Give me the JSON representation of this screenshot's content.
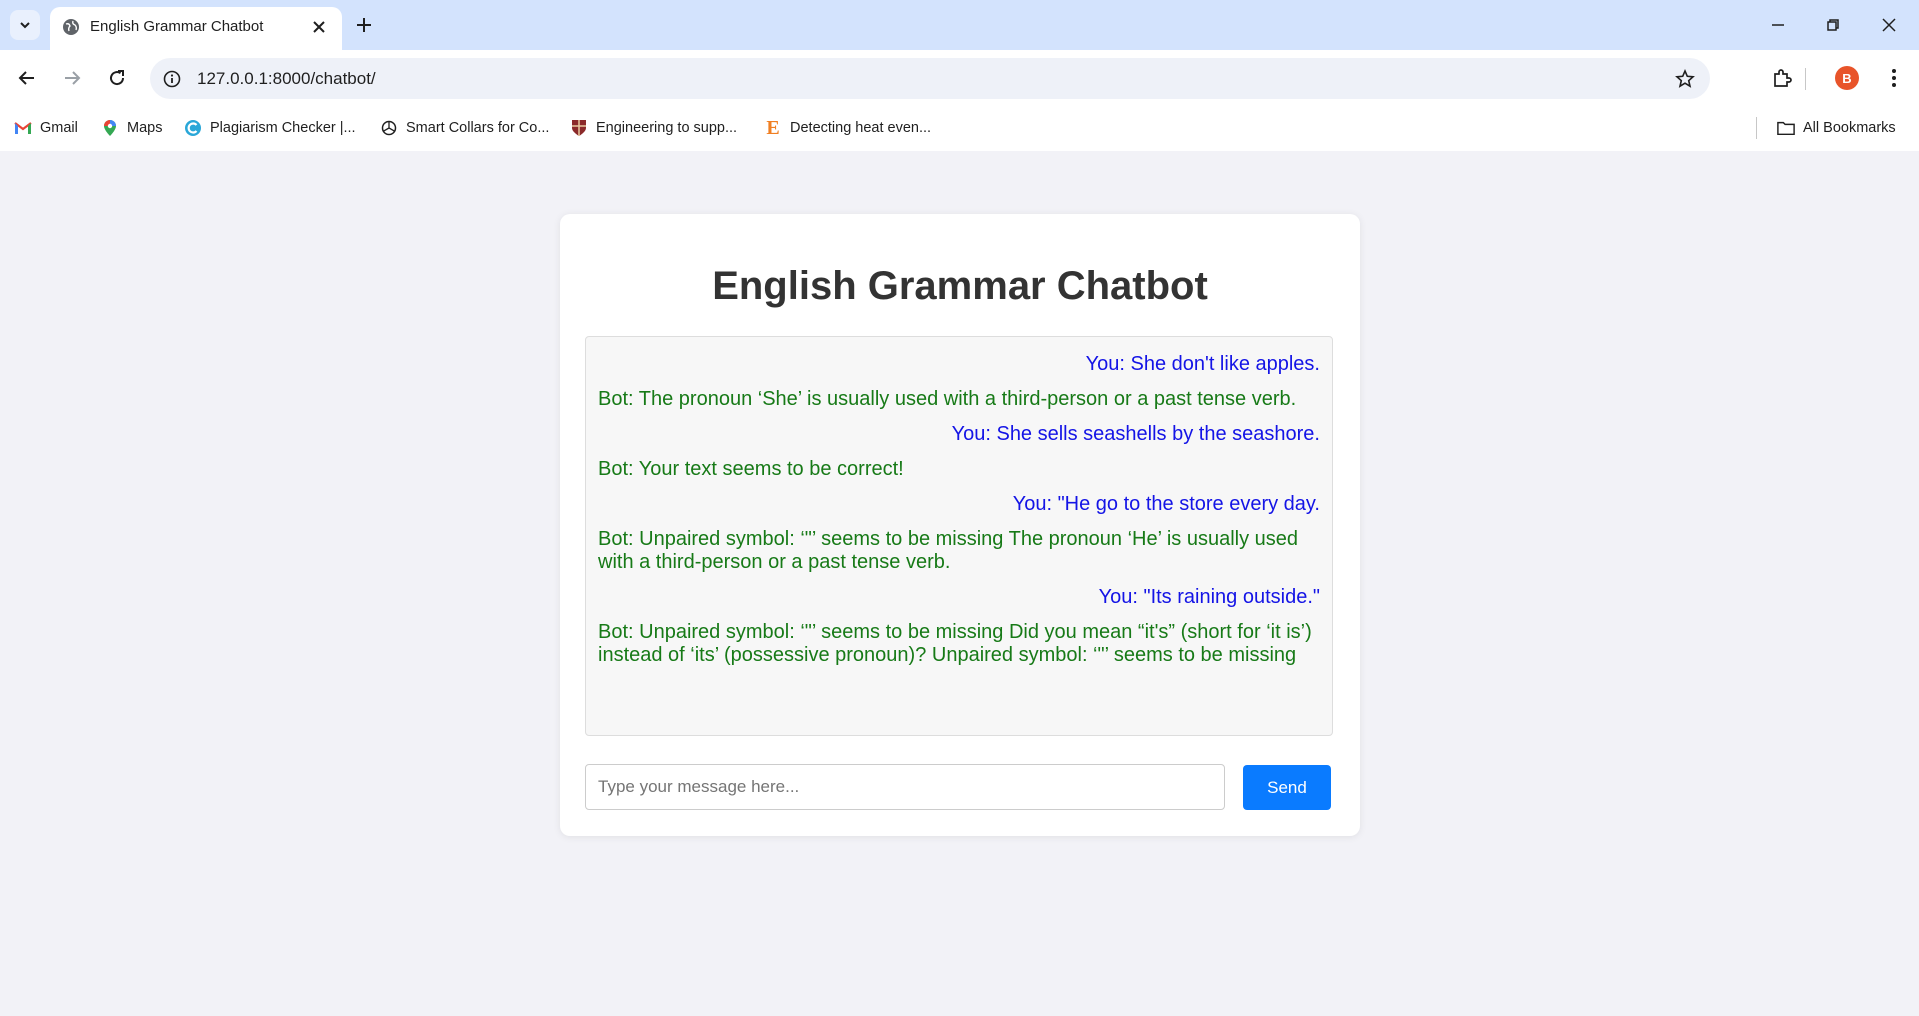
{
  "browser": {
    "tab_title": "English Grammar Chatbot",
    "url": "127.0.0.1:8000/chatbot/",
    "profile_initial": "B",
    "bookmarks": [
      {
        "label": "Gmail",
        "icon": "gmail-icon"
      },
      {
        "label": "Maps",
        "icon": "maps-icon"
      },
      {
        "label": "Plagiarism Checker |...",
        "icon": "plagiarism-checker-icon"
      },
      {
        "label": "Smart Collars for Co...",
        "icon": "openai-icon"
      },
      {
        "label": "Engineering to supp...",
        "icon": "shield-crest-icon"
      },
      {
        "label": "Detecting heat even...",
        "icon": "elsevier-icon"
      }
    ],
    "all_bookmarks_label": "All Bookmarks"
  },
  "page": {
    "title": "English Grammar Chatbot",
    "messages": [
      {
        "sender": "user",
        "text": "You: She don't like apples."
      },
      {
        "sender": "bot",
        "text": "Bot: The pronoun ‘She’ is usually used with a third-person or a past tense verb."
      },
      {
        "sender": "user",
        "text": "You: She sells seashells by the seashore."
      },
      {
        "sender": "bot",
        "text": "Bot: Your text seems to be correct!"
      },
      {
        "sender": "user",
        "text": "You: \"He go to the store every day."
      },
      {
        "sender": "bot",
        "text": "Bot: Unpaired symbol: ‘\"’ seems to be missing The pronoun ‘He’ is usually used with a third-person or a past tense verb."
      },
      {
        "sender": "user",
        "text": "You: \"Its raining outside.\""
      },
      {
        "sender": "bot",
        "text": "Bot: Unpaired symbol: ‘\"’ seems to be missing Did you mean “it's” (short for ‘it is’) instead of ‘its’ (possessive pronoun)? Unpaired symbol: ‘\"’ seems to be missing"
      }
    ],
    "input_placeholder": "Type your message here...",
    "input_value": "",
    "send_label": "Send"
  },
  "colors": {
    "user_text": "#1414e6",
    "bot_text": "#177a17",
    "send_button": "#0a7bff",
    "page_bg": "#f2f2f7"
  }
}
